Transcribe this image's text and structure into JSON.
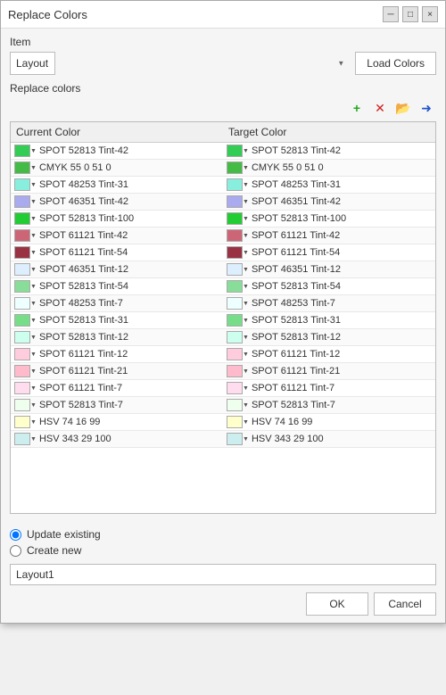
{
  "window": {
    "title": "Replace Colors",
    "minimize_label": "─",
    "maximize_label": "□",
    "close_label": "×"
  },
  "item_label": "Item",
  "dropdown": {
    "value": "Layout",
    "placeholder": "Layout"
  },
  "load_colors_label": "Load Colors",
  "replace_colors_label": "Replace colors",
  "toolbar": {
    "add": "+",
    "remove": "×",
    "folder": "📁",
    "arrow": "→"
  },
  "table": {
    "col_current": "Current Color",
    "col_target": "Target Color"
  },
  "colors": [
    {
      "swatch": "#33cc55",
      "current": "SPOT 52813 Tint-42",
      "target_swatch": "#33cc55",
      "target": "SPOT 52813 Tint-42"
    },
    {
      "swatch": "#44bb44",
      "current": "CMYK 55 0 51 0",
      "target_swatch": "#44bb44",
      "target": "CMYK 55 0 51 0"
    },
    {
      "swatch": "#88eedd",
      "current": "SPOT 48253 Tint-31",
      "target_swatch": "#88eedd",
      "target": "SPOT 48253 Tint-31"
    },
    {
      "swatch": "#aaaaee",
      "current": "SPOT 46351 Tint-42",
      "target_swatch": "#aaaaee",
      "target": "SPOT 46351 Tint-42"
    },
    {
      "swatch": "#22cc33",
      "current": "SPOT 52813 Tint-100",
      "target_swatch": "#22cc33",
      "target": "SPOT 52813 Tint-100"
    },
    {
      "swatch": "#cc6677",
      "current": "SPOT 61121 Tint-42",
      "target_swatch": "#cc6677",
      "target": "SPOT 61121 Tint-42"
    },
    {
      "swatch": "#993344",
      "current": "SPOT 61121 Tint-54",
      "target_swatch": "#993344",
      "target": "SPOT 61121 Tint-54"
    },
    {
      "swatch": "#ddeeff",
      "current": "SPOT 46351 Tint-12",
      "target_swatch": "#ddeeff",
      "target": "SPOT 46351 Tint-12"
    },
    {
      "swatch": "#88dd99",
      "current": "SPOT 52813 Tint-54",
      "target_swatch": "#88dd99",
      "target": "SPOT 52813 Tint-54"
    },
    {
      "swatch": "#eeffff",
      "current": "SPOT 48253 Tint-7",
      "target_swatch": "#eeffff",
      "target": "SPOT 48253 Tint-7"
    },
    {
      "swatch": "#77dd88",
      "current": "SPOT 52813 Tint-31",
      "target_swatch": "#77dd88",
      "target": "SPOT 52813 Tint-31"
    },
    {
      "swatch": "#ccffee",
      "current": "SPOT 52813 Tint-12",
      "target_swatch": "#ccffee",
      "target": "SPOT 52813 Tint-12"
    },
    {
      "swatch": "#ffccdd",
      "current": "SPOT 61121 Tint-12",
      "target_swatch": "#ffccdd",
      "target": "SPOT 61121 Tint-12"
    },
    {
      "swatch": "#ffbbcc",
      "current": "SPOT 61121 Tint-21",
      "target_swatch": "#ffbbcc",
      "target": "SPOT 61121 Tint-21"
    },
    {
      "swatch": "#ffddee",
      "current": "SPOT 61121 Tint-7",
      "target_swatch": "#ffddee",
      "target": "SPOT 61121 Tint-7"
    },
    {
      "swatch": "#eeffee",
      "current": "SPOT 52813 Tint-7",
      "target_swatch": "#eeffee",
      "target": "SPOT 52813 Tint-7"
    },
    {
      "swatch": "#ffffcc",
      "current": "HSV 74 16 99",
      "target_swatch": "#ffffcc",
      "target": "HSV 74 16 99"
    },
    {
      "swatch": "#cceeee",
      "current": "HSV 343 29 100",
      "target_swatch": "#cceeee",
      "target": "HSV 343 29 100"
    }
  ],
  "radio": {
    "update_existing_label": "Update existing",
    "create_new_label": "Create new",
    "selected": "update_existing"
  },
  "name_input": {
    "value": "Layout1"
  },
  "buttons": {
    "ok": "OK",
    "cancel": "Cancel"
  }
}
